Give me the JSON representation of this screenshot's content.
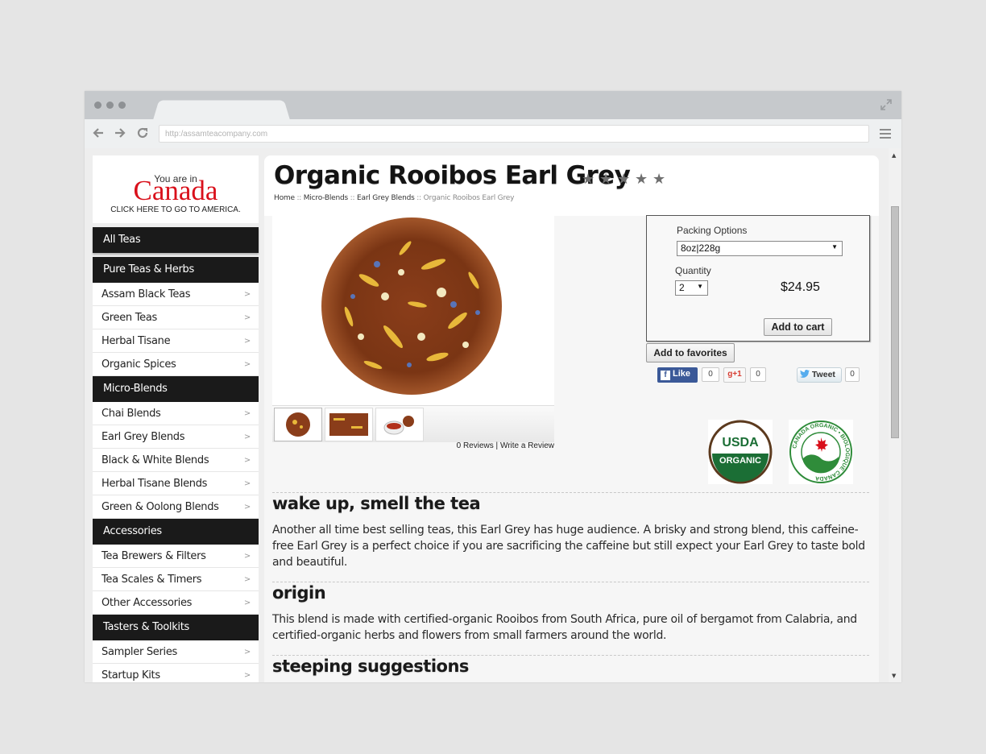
{
  "browser": {
    "url": "http:/assamteacompany.com"
  },
  "location": {
    "prefix": "You are in",
    "country": "Canada",
    "switch_link": "CLICK HERE TO GO TO AMERICA."
  },
  "sidebar": {
    "all_teas": "All Teas",
    "groups": [
      {
        "title": "Pure Teas & Herbs",
        "items": [
          "Assam Black Teas",
          "Green Teas",
          "Herbal Tisane",
          "Organic Spices"
        ]
      },
      {
        "title": "Micro-Blends",
        "items": [
          "Chai Blends",
          "Earl Grey Blends",
          "Black & White Blends",
          "Herbal Tisane Blends",
          "Green & Oolong Blends"
        ]
      },
      {
        "title": "Accessories",
        "items": [
          "Tea Brewers & Filters",
          "Tea Scales & Timers",
          "Other Accessories"
        ]
      },
      {
        "title": "Tasters & Toolkits",
        "items": [
          "Sampler Series",
          "Startup Kits"
        ]
      }
    ]
  },
  "product": {
    "title": "Organic Rooibos Earl Grey",
    "rating_stars": 5,
    "breadcrumb": [
      "Home",
      "Micro-Blends",
      "Earl Grey Blends",
      "Organic Rooibos Earl Grey"
    ],
    "breadcrumb_sep": " :: ",
    "reviews_count": "0 Reviews",
    "review_sep": "|",
    "write_review": "Write a Review"
  },
  "purchase": {
    "packing_label": "Packing Options",
    "packing_value": "8oz|228g",
    "quantity_label": "Quantity",
    "quantity_value": "2",
    "price": "$24.95",
    "add_to_cart": "Add to cart",
    "add_to_favorites": "Add to favorites"
  },
  "social": {
    "like_label": "Like",
    "like_count": "0",
    "gplus_label": "+1",
    "gplus_count": "0",
    "tweet_label": "Tweet",
    "tweet_count": "0"
  },
  "badges": {
    "usda_line1": "USDA",
    "usda_line2": "ORGANIC",
    "canada_ring": "CANADA ORGANIC • BIOLOGIQUE CANADA"
  },
  "sections": [
    {
      "heading": "wake up, smell the tea",
      "body": "Another all time best selling teas, this Earl Grey has huge audience. A brisky and strong blend, this caffeine-free Earl Grey is a perfect choice if you are sacrificing the caffeine but still expect your Earl Grey to taste bold and beautiful."
    },
    {
      "heading": "origin",
      "body": "This blend is made with certified-organic Rooibos from South Africa, pure oil of bergamot from Calabria, and certified-organic herbs and flowers from small farmers around the world."
    },
    {
      "heading": "steeping suggestions",
      "body": ""
    }
  ],
  "colors": {
    "canada_red": "#d9101b",
    "category_header_bg": "#1a1a1a",
    "facebook_blue": "#3b5998",
    "usda_green": "#1b6e35"
  }
}
